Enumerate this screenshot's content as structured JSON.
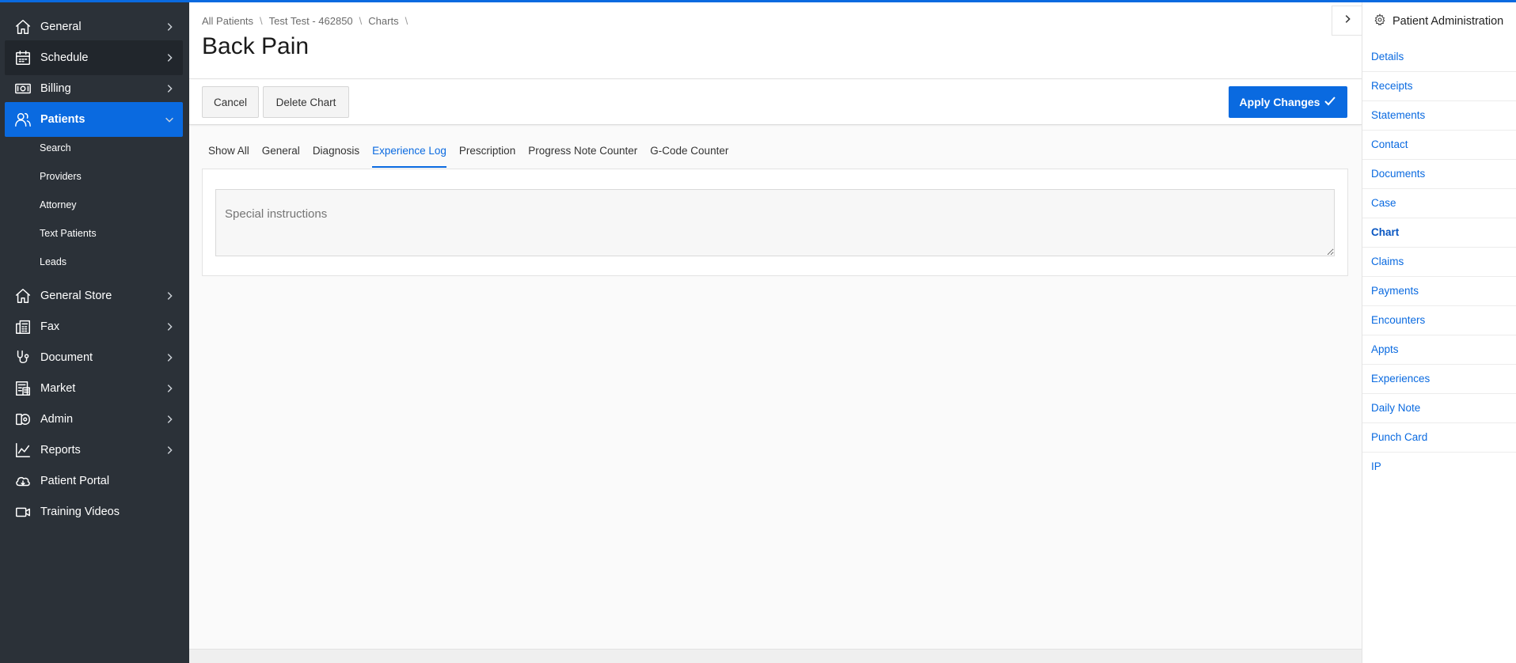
{
  "sidebar": {
    "items": [
      {
        "label": "General",
        "icon": "home-icon"
      },
      {
        "label": "Schedule",
        "icon": "calendar-icon"
      },
      {
        "label": "Billing",
        "icon": "money-icon"
      },
      {
        "label": "Patients",
        "icon": "users-icon"
      },
      {
        "label": "General Store",
        "icon": "home-icon"
      },
      {
        "label": "Fax",
        "icon": "fax-icon"
      },
      {
        "label": "Document",
        "icon": "stethoscope-icon"
      },
      {
        "label": "Market",
        "icon": "market-icon"
      },
      {
        "label": "Admin",
        "icon": "admin-icon"
      },
      {
        "label": "Reports",
        "icon": "chart-icon"
      },
      {
        "label": "Patient Portal",
        "icon": "cloud-icon"
      },
      {
        "label": "Training Videos",
        "icon": "video-icon"
      }
    ],
    "sub_items": [
      "Search",
      "Providers",
      "Attorney",
      "Text Patients",
      "Leads"
    ]
  },
  "breadcrumb": {
    "items": [
      "All Patients",
      "Test Test - 462850",
      "Charts"
    ],
    "separator": "\\"
  },
  "page": {
    "title": "Back Pain"
  },
  "toolbar": {
    "cancel": "Cancel",
    "delete": "Delete Chart",
    "apply": "Apply Changes"
  },
  "tabs": [
    "Show All",
    "General",
    "Diagnosis",
    "Experience Log",
    "Prescription",
    "Progress Note Counter",
    "G-Code Counter"
  ],
  "active_tab": "Experience Log",
  "form": {
    "special_instructions_placeholder": "Special instructions"
  },
  "right_panel": {
    "title": "Patient Administration",
    "items": [
      "Details",
      "Receipts",
      "Statements",
      "Contact",
      "Documents",
      "Case",
      "Chart",
      "Claims",
      "Payments",
      "Encounters",
      "Appts",
      "Experiences",
      "Daily Note",
      "Punch Card",
      "IP"
    ],
    "active": "Chart"
  },
  "colors": {
    "accent": "#0a6ae0",
    "sidebar": "#2b3138"
  }
}
